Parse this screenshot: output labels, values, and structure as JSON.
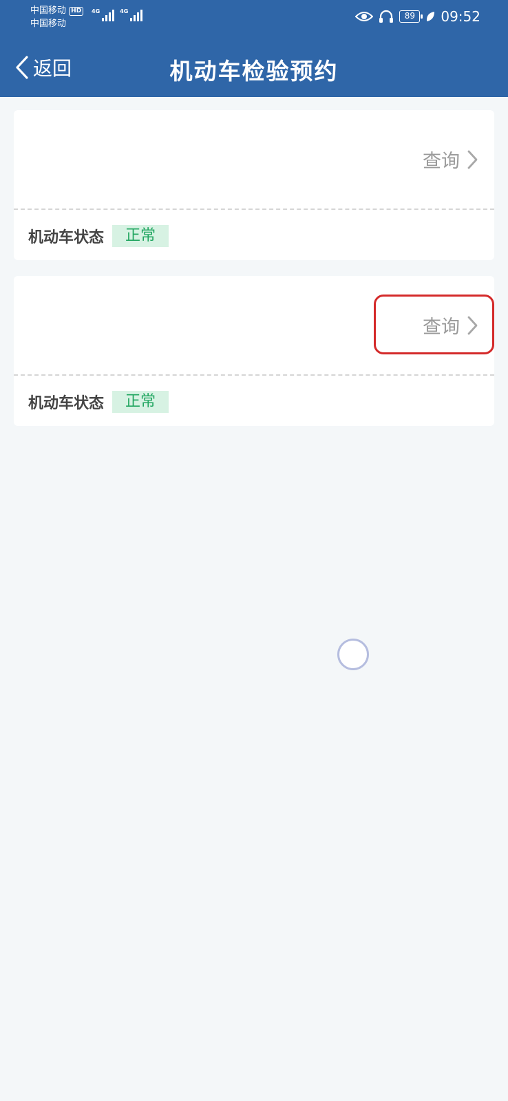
{
  "status_bar": {
    "carrier1": "中国移动",
    "hd_badge": "HD",
    "carrier2": "中国移动",
    "network1": "4G",
    "network2": "4G",
    "battery": "89",
    "time": "09:52",
    "icons": [
      "eye-icon",
      "headphones-icon",
      "battery-icon",
      "leaf-icon"
    ]
  },
  "nav": {
    "back_label": "返回",
    "title": "机动车检验预约"
  },
  "cards": [
    {
      "query_label": "查询",
      "status_label": "机动车状态",
      "status_value": "正常"
    },
    {
      "query_label": "查询",
      "status_label": "机动车状态",
      "status_value": "正常"
    }
  ],
  "colors": {
    "header": "#2f66a8",
    "background": "#f4f7f9",
    "status_green": "#22a661",
    "highlight_red": "#d42a2a"
  }
}
